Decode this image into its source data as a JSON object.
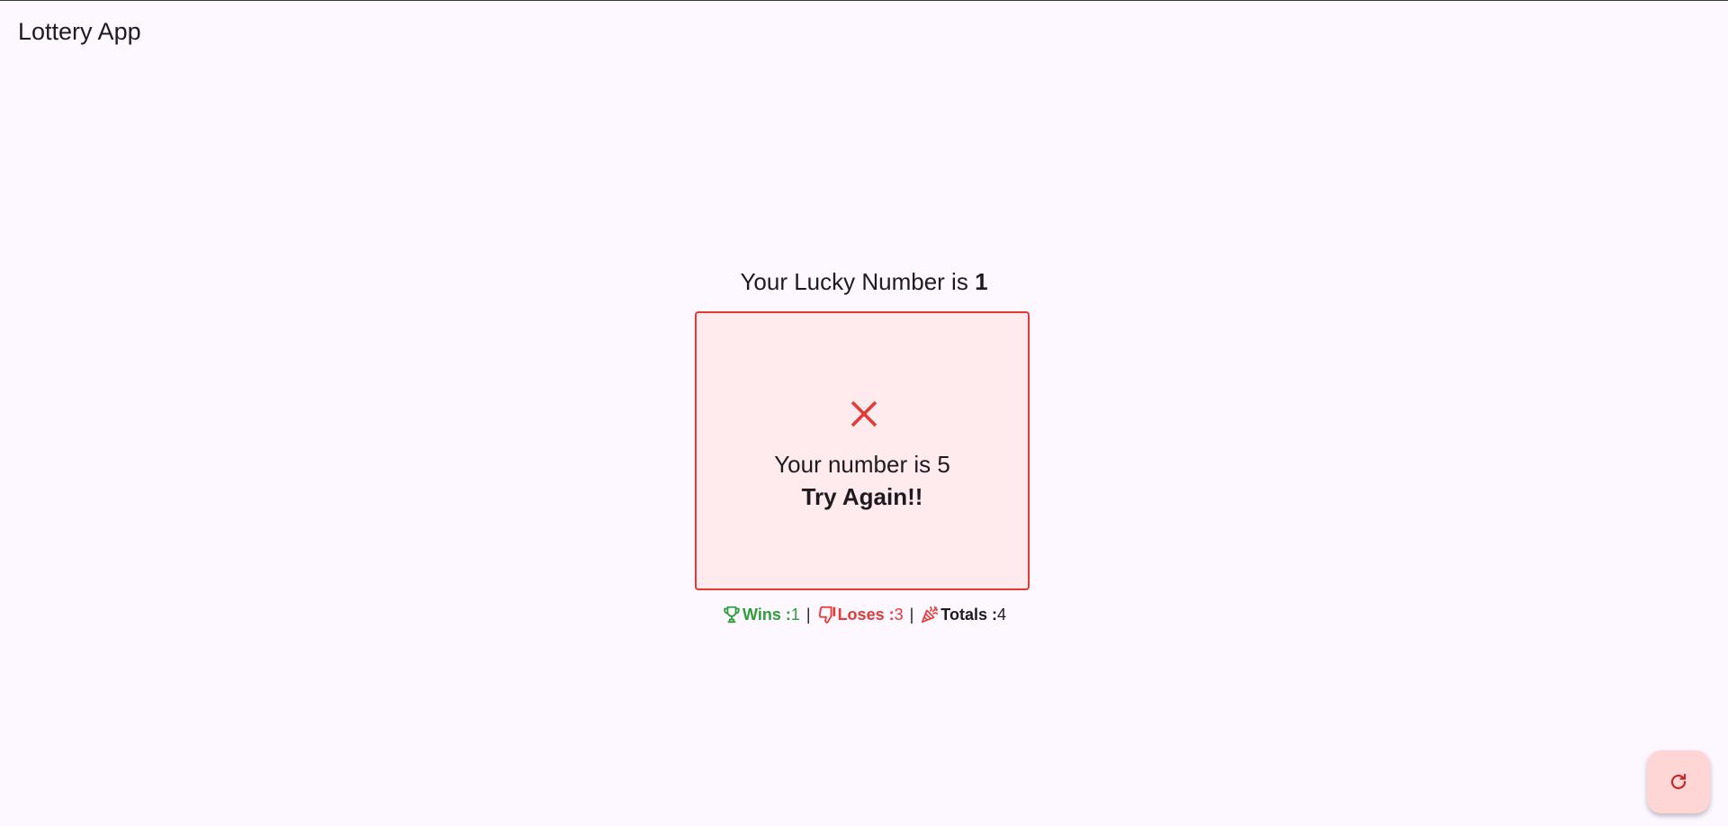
{
  "app_bar": {
    "title": "Lottery App"
  },
  "lucky": {
    "prefix": "Your Lucky Number is ",
    "number": "1"
  },
  "result": {
    "status": "lose",
    "icon": "close-icon",
    "line1": "Your number is 5",
    "line2": "Try Again!!",
    "border_color": "#e53935",
    "background_color": "#ffebee"
  },
  "stats": {
    "wins_label": "Wins : ",
    "wins_value": "1",
    "loses_label": "Loses : ",
    "loses_value": "3",
    "totals_label": "Totals : ",
    "totals_value": "4",
    "separator": "|",
    "wins_icon": "trophy-icon",
    "loses_icon": "thumbs-down-icon",
    "totals_icon": "party-popper-icon",
    "wins_color": "#2e9e3a",
    "loses_color": "#e53935"
  },
  "fab": {
    "icon": "refresh-icon",
    "background_color": "#ffd6d6"
  }
}
